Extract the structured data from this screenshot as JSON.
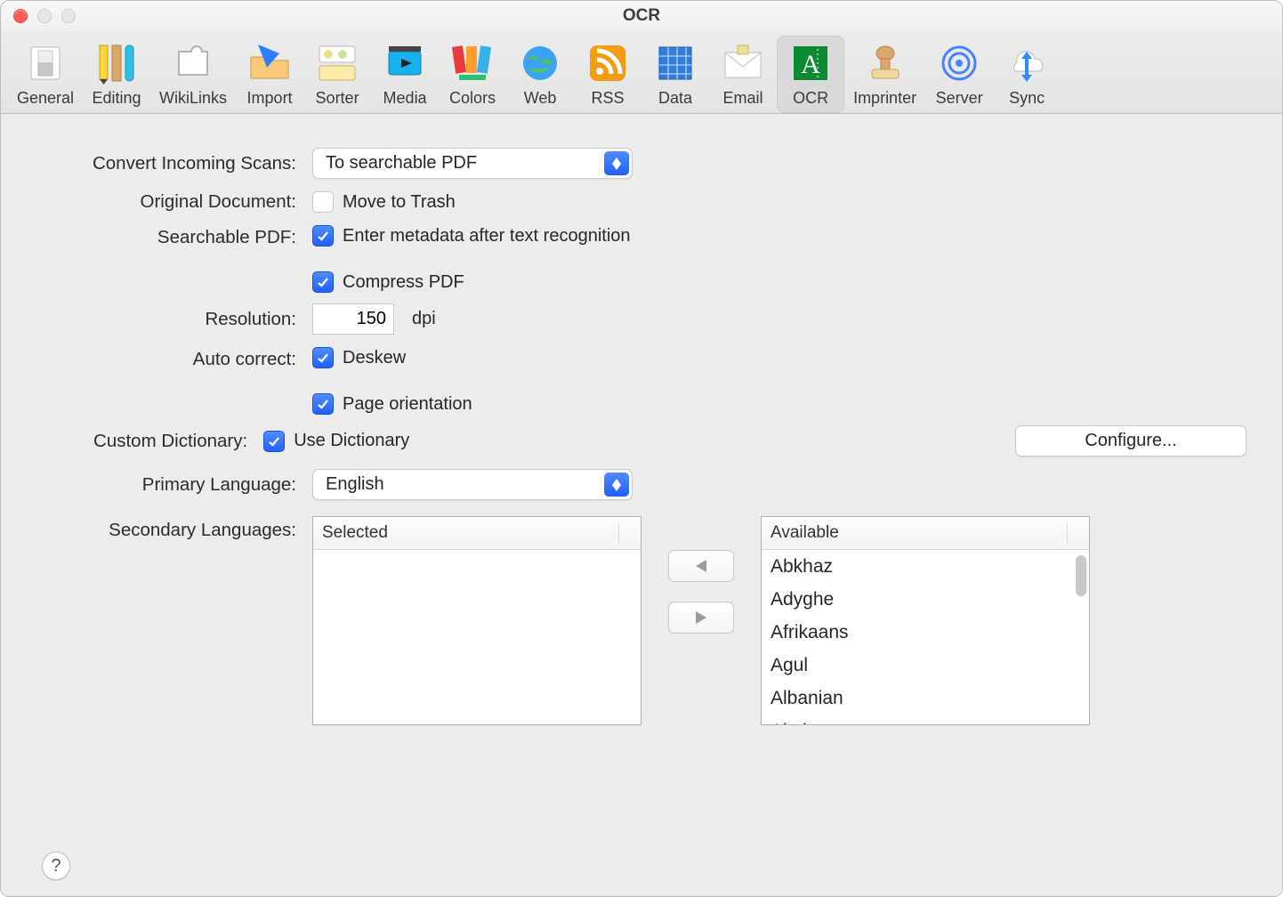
{
  "window": {
    "title": "OCR"
  },
  "toolbar": {
    "active_index": 13,
    "items": [
      {
        "label": "General"
      },
      {
        "label": "Editing"
      },
      {
        "label": "WikiLinks"
      },
      {
        "label": "Import"
      },
      {
        "label": "Sorter"
      },
      {
        "label": "Media"
      },
      {
        "label": "Colors"
      },
      {
        "label": "Web"
      },
      {
        "label": "RSS"
      },
      {
        "label": "Data"
      },
      {
        "label": "Email"
      },
      {
        "label": "OCR"
      },
      {
        "label": "Imprinter"
      },
      {
        "label": "Server"
      },
      {
        "label": "Sync"
      }
    ]
  },
  "form": {
    "convert_label": "Convert Incoming Scans:",
    "convert_value": "To searchable PDF",
    "original_label": "Original Document:",
    "move_trash": "Move to Trash",
    "searchable_label": "Searchable PDF:",
    "enter_metadata": "Enter metadata after text recognition",
    "compress_pdf": "Compress PDF",
    "resolution_label": "Resolution:",
    "resolution_value": "150",
    "resolution_unit": "dpi",
    "autocorrect_label": "Auto correct:",
    "deskew": "Deskew",
    "page_orientation": "Page orientation",
    "custom_dict_label": "Custom Dictionary:",
    "use_dictionary": "Use Dictionary",
    "configure": "Configure...",
    "primary_label": "Primary Language:",
    "primary_value": "English",
    "secondary_label": "Secondary Languages:",
    "selected_header": "Selected",
    "available_header": "Available",
    "available_items": [
      "Abkhaz",
      "Adyghe",
      "Afrikaans",
      "Agul",
      "Albanian",
      "Altaic"
    ]
  },
  "help": "?"
}
